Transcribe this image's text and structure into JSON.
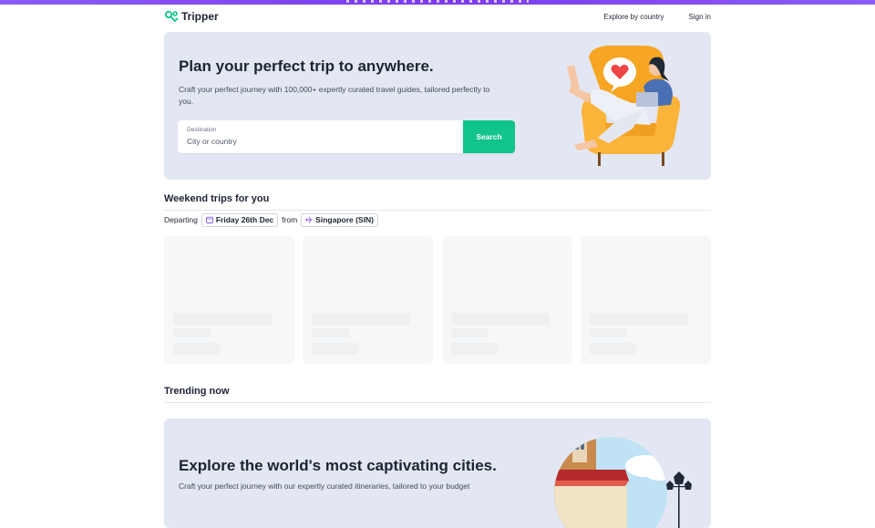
{
  "brand": {
    "name": "Tripper",
    "accent": "#10c48b",
    "top_strip_color": "#8b5cf6"
  },
  "nav": {
    "explore": "Explore by country",
    "signin": "Sign in"
  },
  "hero": {
    "title": "Plan your perfect trip to anywhere.",
    "subtitle": "Craft your perfect journey with 100,000+ expertly curated travel guides, tailored perfectly to you.",
    "destination_label": "Destination",
    "destination_placeholder": "City or country",
    "search_label": "Search"
  },
  "weekend": {
    "title": "Weekend trips for you",
    "departing_label": "Departing",
    "date": "Friday 26th Dec",
    "from_label": "from",
    "origin": "Singapore (SIN)",
    "cards_loading": 4
  },
  "trending": {
    "title": "Trending now"
  },
  "promo": {
    "title": "Explore the world's most captivating cities.",
    "subtitle": "Craft your perfect journey with our expertly curated itineraries, tailored to your budget"
  },
  "icons": {
    "logo": "tripper-logo-icon",
    "calendar": "calendar-icon",
    "plane": "airplane-icon"
  }
}
